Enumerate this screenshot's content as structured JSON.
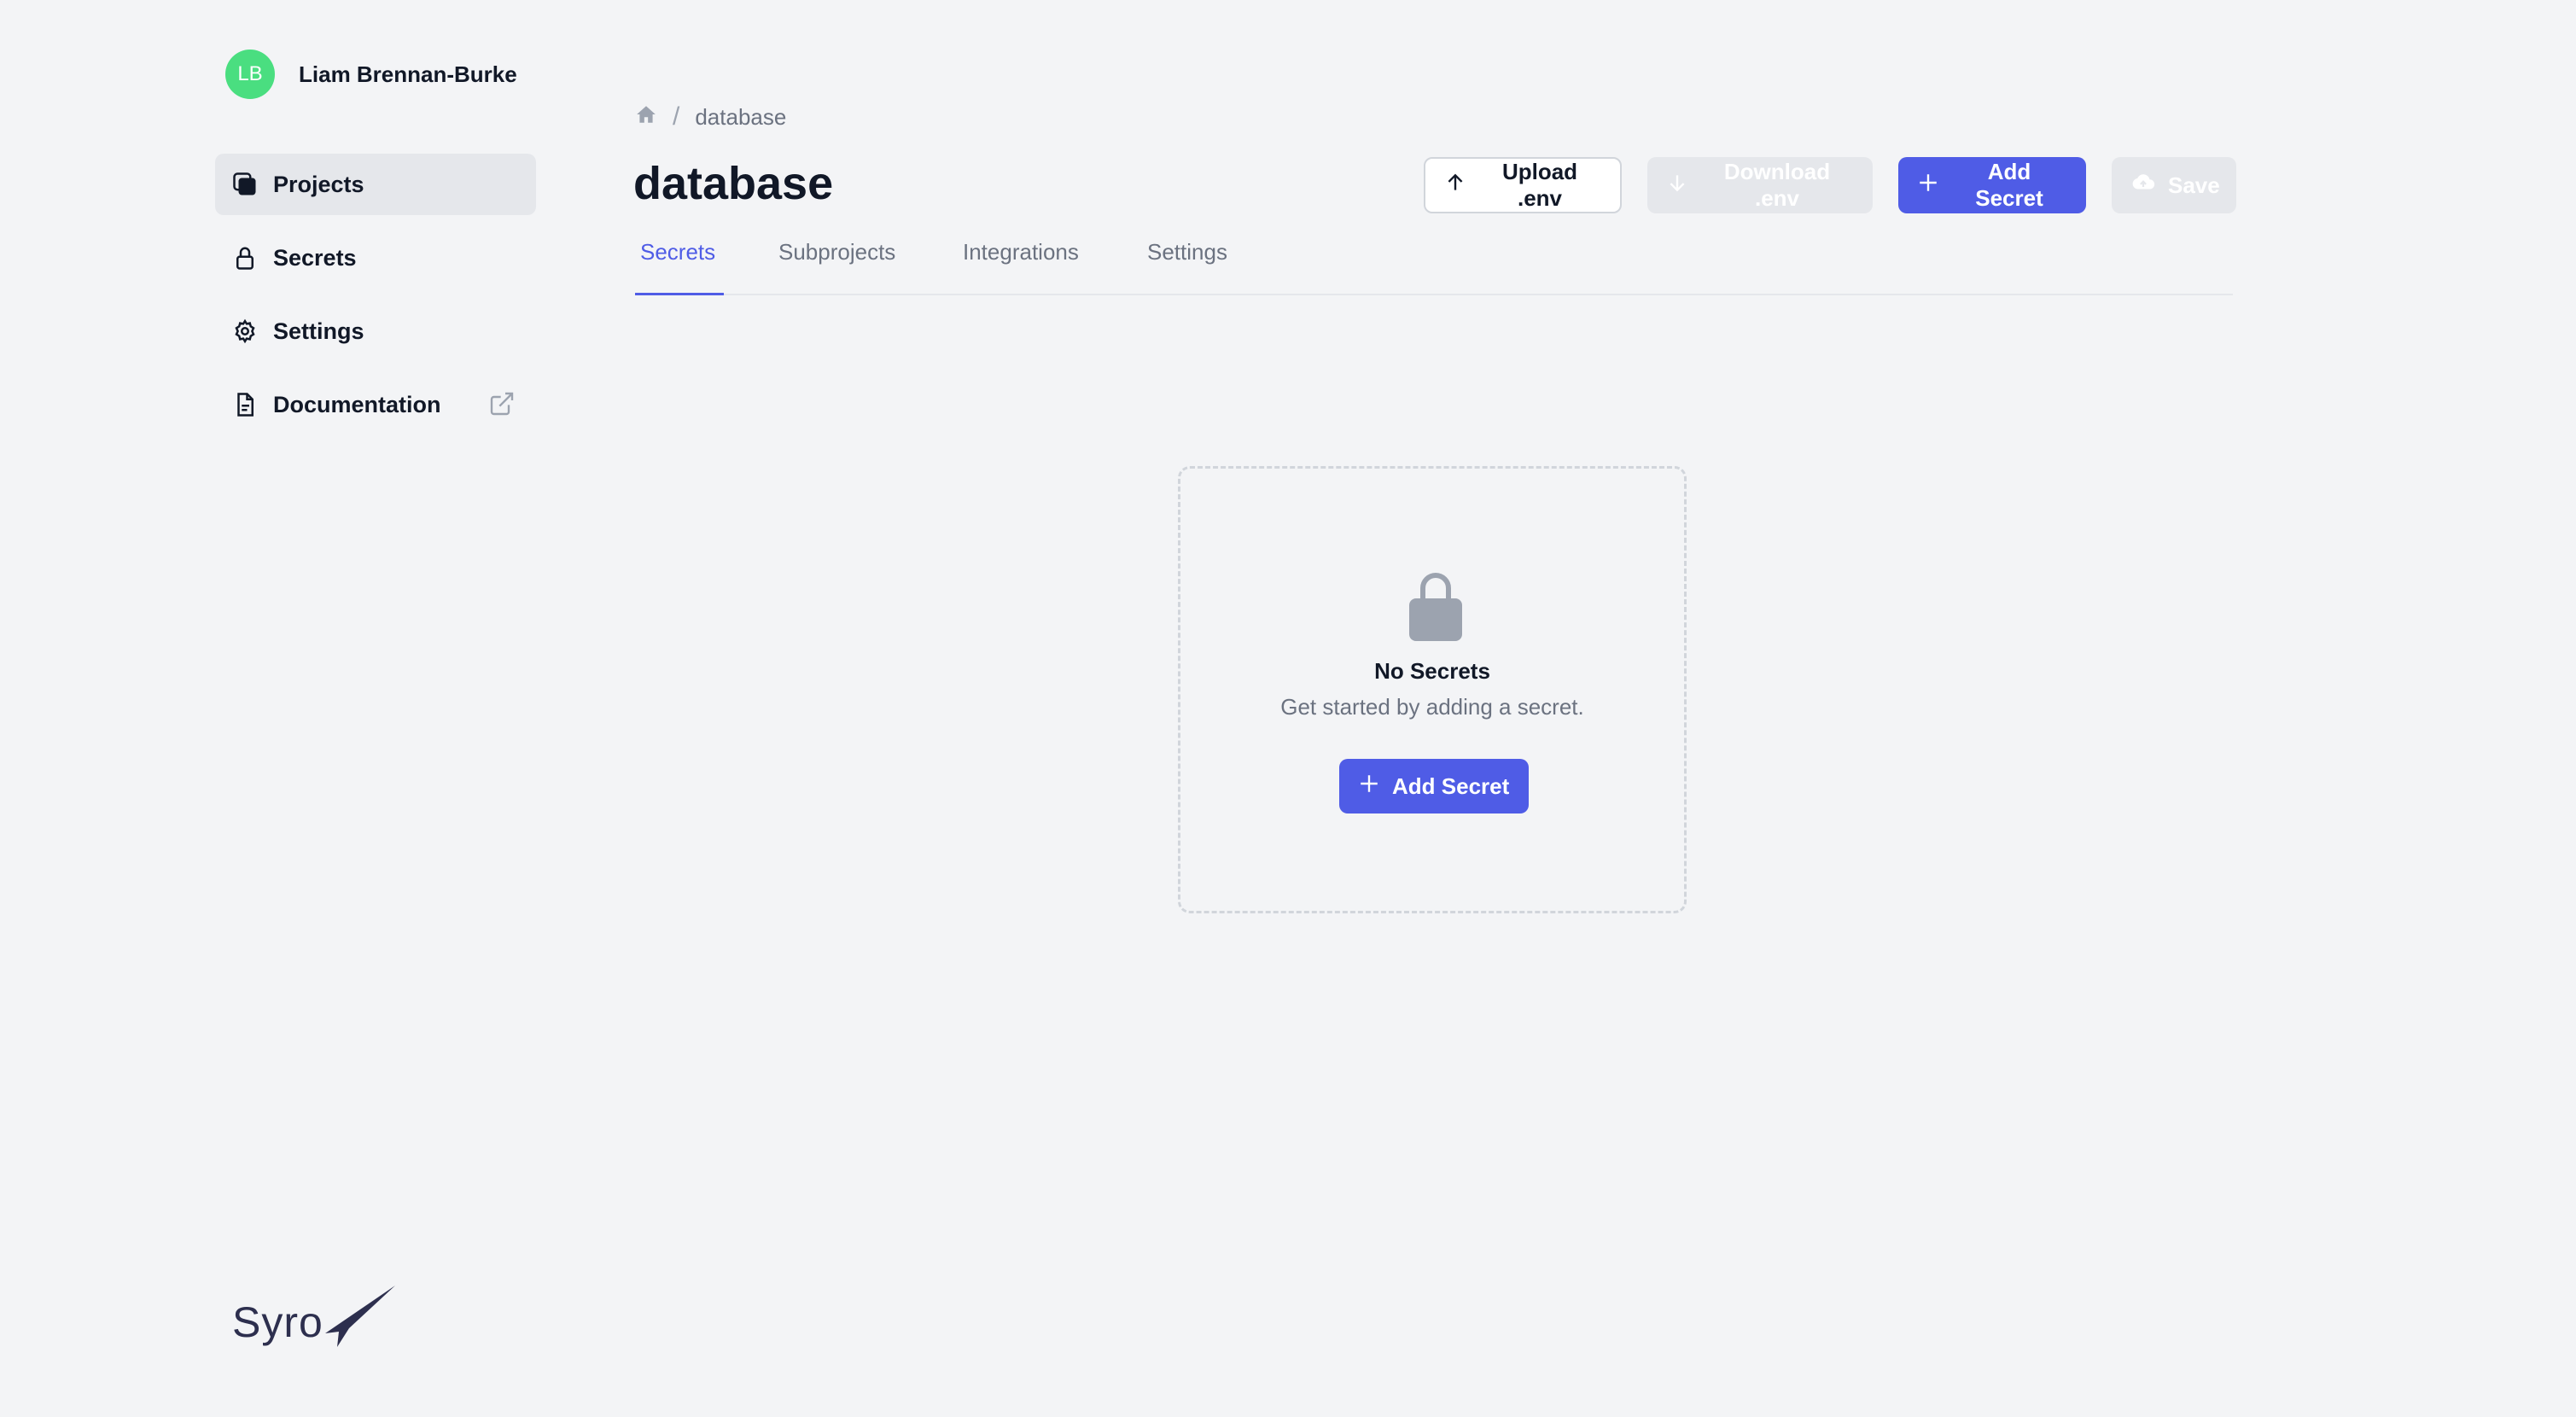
{
  "user": {
    "initials": "LB",
    "name": "Liam Brennan-Burke"
  },
  "sidebar": {
    "items": [
      {
        "label": "Projects",
        "icon": "projects-icon",
        "active": true
      },
      {
        "label": "Secrets",
        "icon": "lock-icon",
        "active": false
      },
      {
        "label": "Settings",
        "icon": "gear-icon",
        "active": false
      },
      {
        "label": "Documentation",
        "icon": "document-icon",
        "active": false,
        "external": true
      }
    ]
  },
  "logo": {
    "text": "Syro"
  },
  "breadcrumb": {
    "home_icon": "home-icon",
    "separator": "/",
    "current": "database"
  },
  "page": {
    "title": "database"
  },
  "toolbar": {
    "upload_label": "Upload .env",
    "download_label": "Download .env",
    "add_secret_label": "Add Secret",
    "save_label": "Save"
  },
  "tabs": [
    {
      "label": "Secrets",
      "active": true
    },
    {
      "label": "Subprojects",
      "active": false
    },
    {
      "label": "Integrations",
      "active": false
    },
    {
      "label": "Settings",
      "active": false
    }
  ],
  "empty_state": {
    "icon": "lock-icon",
    "title": "No Secrets",
    "description": "Get started by adding a secret.",
    "button_label": "Add Secret"
  },
  "colors": {
    "background": "#f3f4f6",
    "accent": "#4f5ce6",
    "avatar": "#4ade80",
    "sidebar_active": "#e5e7eb",
    "muted_text": "#6b7280"
  }
}
